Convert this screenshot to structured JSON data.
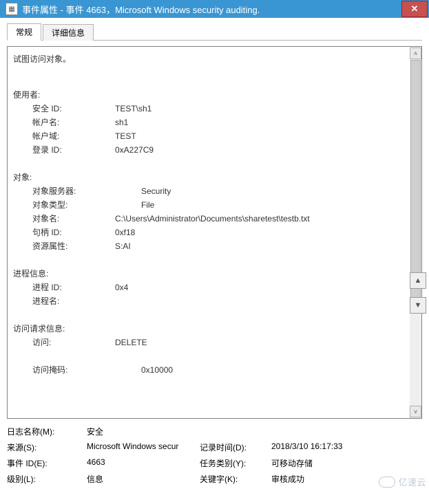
{
  "window": {
    "title": "事件属性 - 事件 4663，Microsoft Windows security auditing."
  },
  "tabs": {
    "general": "常规",
    "details": "详细信息"
  },
  "body": {
    "intro": "试图访问对象。",
    "user_section": "使用者:",
    "user": {
      "sid_label": "安全 ID:",
      "sid_value": "TEST\\sh1",
      "account_label": "帐户名:",
      "account_value": "sh1",
      "domain_label": "帐户域:",
      "domain_value": "TEST",
      "logon_label": "登录 ID:",
      "logon_value": "0xA227C9"
    },
    "object_section": "对象:",
    "object": {
      "server_label": "对象服务器:",
      "server_value": "Security",
      "type_label": "对象类型:",
      "type_value": "File",
      "name_label": "对象名:",
      "name_value": "C:\\Users\\Administrator\\Documents\\sharetest\\testb.txt",
      "handle_label": "句柄 ID:",
      "handle_value": "0xf18",
      "resattr_label": "资源属性:",
      "resattr_value": "S:AI"
    },
    "process_section": "进程信息:",
    "process": {
      "pid_label": "进程 ID:",
      "pid_value": "0x4",
      "pname_label": "进程名:",
      "pname_value": ""
    },
    "access_section": "访问请求信息:",
    "access": {
      "access_label": "访问:",
      "access_value": "DELETE",
      "mask_label": "访问掩码:",
      "mask_value": "0x10000"
    }
  },
  "footer": {
    "logname_label": "日志名称(M):",
    "logname_value": "安全",
    "source_label": "来源(S):",
    "source_value": "Microsoft Windows secur",
    "logged_label": "记录时间(D):",
    "logged_value": "2018/3/10 16:17:33",
    "eventid_label": "事件 ID(E):",
    "eventid_value": "4663",
    "taskcat_label": "任务类别(Y):",
    "taskcat_value": "可移动存储",
    "level_label": "级别(L):",
    "level_value": "信息",
    "keywords_label": "关键字(K):",
    "keywords_value": "审核成功"
  },
  "watermark": "亿速云"
}
